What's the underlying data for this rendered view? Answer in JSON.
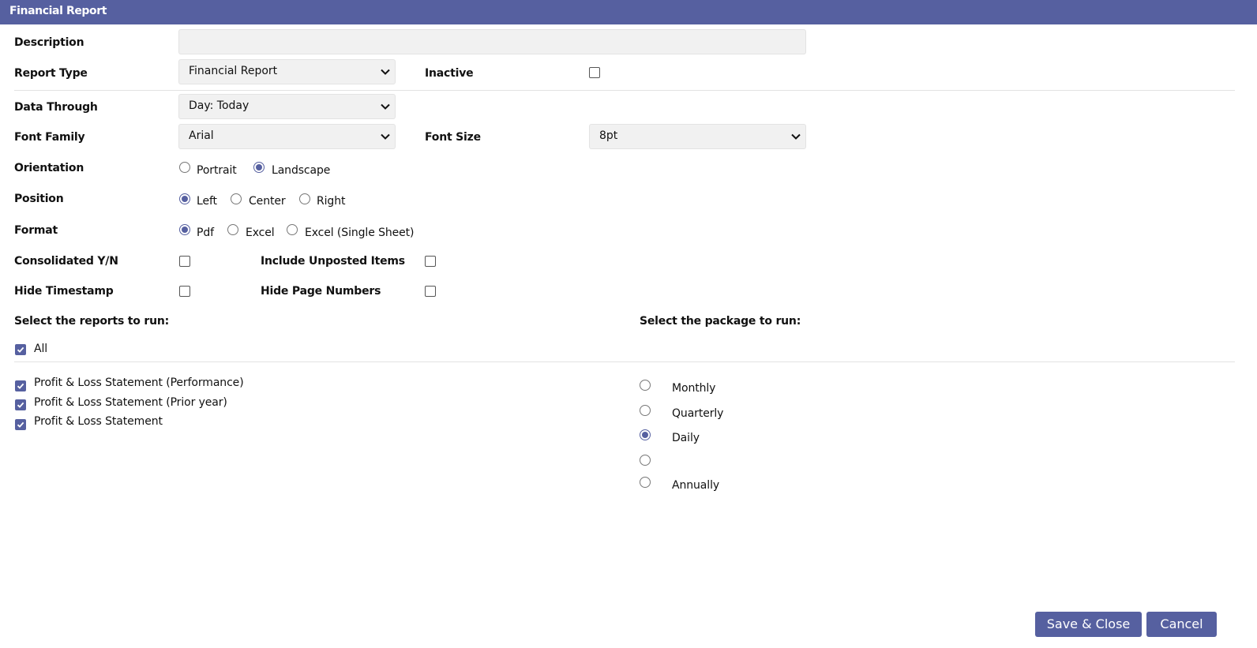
{
  "window": {
    "title": "Financial Report"
  },
  "form": {
    "description": {
      "label": "Description",
      "value": ""
    },
    "report_type": {
      "label": "Report Type",
      "value": "Financial Report"
    },
    "inactive": {
      "label": "Inactive",
      "checked": false
    },
    "data_through": {
      "label": "Data Through",
      "value": "Day: Today"
    },
    "font_family": {
      "label": "Font Family",
      "value": "Arial"
    },
    "font_size": {
      "label": "Font Size",
      "value": "8pt"
    },
    "orientation": {
      "label": "Orientation",
      "options": [
        "Portrait",
        "Landscape"
      ],
      "selected": "Landscape"
    },
    "position": {
      "label": "Position",
      "options": [
        "Left",
        "Center",
        "Right"
      ],
      "selected": "Left"
    },
    "format": {
      "label": "Format",
      "options": [
        "Pdf",
        "Excel",
        "Excel (Single Sheet)"
      ],
      "selected": "Pdf"
    },
    "consolidated": {
      "label": "Consolidated Y/N",
      "checked": false
    },
    "include_unposted": {
      "label": "Include Unposted Items",
      "checked": false
    },
    "hide_timestamp": {
      "label": "Hide Timestamp",
      "checked": false
    },
    "hide_page_numbers": {
      "label": "Hide Page Numbers",
      "checked": false
    }
  },
  "reports": {
    "heading": "Select the reports to run:",
    "all": {
      "label": "All",
      "checked": true
    },
    "items": [
      {
        "label": "Profit & Loss Statement (Performance)",
        "checked": true
      },
      {
        "label": "Profit & Loss Statement (Prior year)",
        "checked": true
      },
      {
        "label": "Profit & Loss Statement",
        "checked": true
      }
    ]
  },
  "package": {
    "heading": "Select the package to run:",
    "options": [
      "Monthly",
      "Quarterly",
      "Daily",
      "",
      "Annually"
    ],
    "selected": "Daily"
  },
  "buttons": {
    "save_close": "Save & Close",
    "cancel": "Cancel"
  },
  "colors": {
    "accent": "#5660a0",
    "field_bg": "#f1f1f1",
    "divider": "#e2e2e2"
  }
}
